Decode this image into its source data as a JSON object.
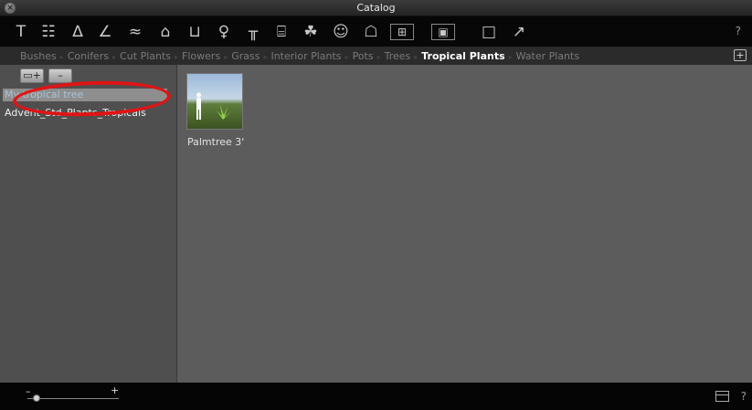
{
  "window": {
    "title": "Catalog"
  },
  "toolbar": {
    "icons": [
      {
        "name": "paint-roller-icon",
        "glyph": "Τ"
      },
      {
        "name": "brick-wall-icon",
        "glyph": "☷"
      },
      {
        "name": "stairs-icon",
        "glyph": "∆"
      },
      {
        "name": "brush-icon",
        "glyph": "∠"
      },
      {
        "name": "water-texture-icon",
        "glyph": "≈"
      },
      {
        "name": "sofa-icon",
        "glyph": "⌂"
      },
      {
        "name": "sink-icon",
        "glyph": "⊔"
      },
      {
        "name": "lamp-icon",
        "glyph": "♀"
      },
      {
        "name": "table-icon",
        "glyph": "╥"
      },
      {
        "name": "car-icon",
        "glyph": "⌸"
      },
      {
        "name": "plant-icon",
        "glyph": "☘"
      },
      {
        "name": "people-icon",
        "glyph": "☺"
      },
      {
        "name": "building-icon",
        "glyph": "☖"
      },
      {
        "name": "selection-box-icon",
        "glyph": "⊞"
      },
      {
        "name": "image-icon",
        "glyph": "▣"
      },
      {
        "name": "folder-icon",
        "glyph": "□"
      },
      {
        "name": "cursor-icon",
        "glyph": "↗"
      }
    ],
    "help": "?"
  },
  "categories": [
    {
      "label": "Bushes",
      "active": false
    },
    {
      "label": "Conifers",
      "active": false
    },
    {
      "label": "Cut Plants",
      "active": false
    },
    {
      "label": "Flowers",
      "active": false
    },
    {
      "label": "Grass",
      "active": false
    },
    {
      "label": "Interior Plants",
      "active": false
    },
    {
      "label": "Pots",
      "active": false
    },
    {
      "label": "Trees",
      "active": false
    },
    {
      "label": "Tropical Plants",
      "active": true
    },
    {
      "label": "Water Plants",
      "active": false
    }
  ],
  "new_folder_symbol": "+",
  "left_panel": {
    "add_folder_symbol": "▭+",
    "remove_symbol": "–",
    "items": [
      {
        "label": "My tropical tree",
        "selected": true
      },
      {
        "label": "Advent_Std_Plants_Tropicals",
        "selected": false
      }
    ]
  },
  "content": {
    "items": [
      {
        "label": "Palmtree 3'"
      }
    ]
  },
  "bottom_bar": {
    "zoom_minus": "–",
    "zoom_plus": "+",
    "zoom_level": 0.1,
    "help": "?"
  },
  "colors": {
    "annotation": "#e01414",
    "active_category": "#ffffff",
    "selected_item_text": "#aac4d9"
  }
}
